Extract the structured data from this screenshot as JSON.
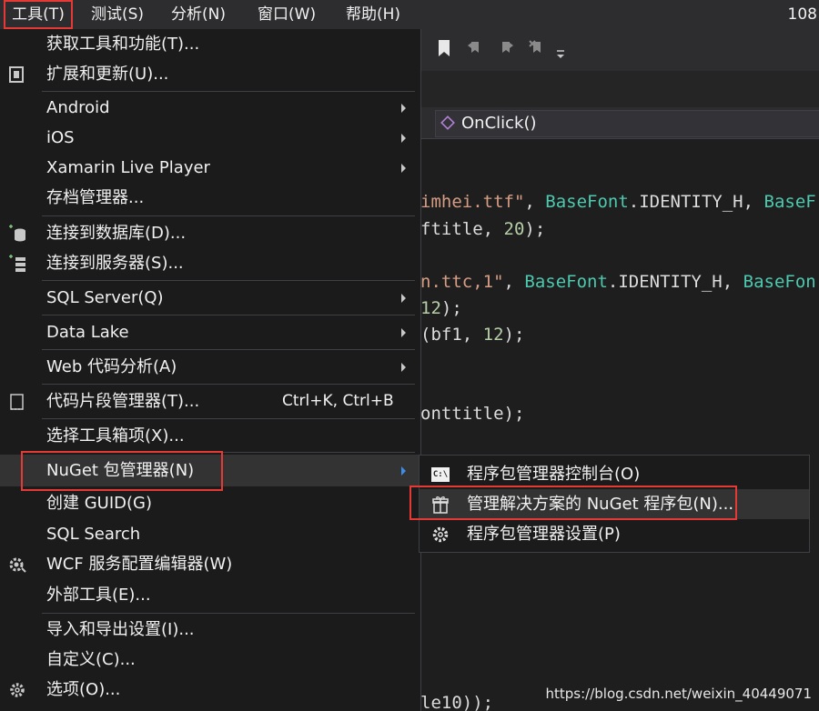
{
  "menubar": {
    "items": [
      "工具(T)",
      "测试(S)",
      "分析(N)",
      "窗口(W)",
      "帮助(H)"
    ],
    "right_text": "108"
  },
  "nav": {
    "method": "OnClick()"
  },
  "code_lines": [
    {
      "parts": [
        [
          "str",
          "imhei.ttf\""
        ],
        [
          "pln",
          ", "
        ],
        [
          "typ",
          "BaseFont"
        ],
        [
          "pln",
          ".IDENTITY_H, "
        ],
        [
          "typ",
          "BaseF"
        ]
      ]
    },
    {
      "parts": [
        [
          "pln",
          "ftitle, "
        ],
        [
          "num",
          "20"
        ],
        [
          "pln",
          ");"
        ]
      ]
    },
    {
      "parts": [
        [
          "str",
          "n.ttc,1\""
        ],
        [
          "pln",
          ", "
        ],
        [
          "typ",
          "BaseFont"
        ],
        [
          "pln",
          ".IDENTITY_H, "
        ],
        [
          "typ",
          "BaseFon"
        ]
      ]
    },
    {
      "parts": [
        [
          "num",
          "12"
        ],
        [
          "pln",
          ");"
        ]
      ]
    },
    {
      "parts": [
        [
          "pln",
          "(bf1, "
        ],
        [
          "num",
          "12"
        ],
        [
          "pln",
          ");"
        ]
      ]
    },
    {
      "parts": [
        [
          "pln",
          "onttitle);"
        ]
      ]
    },
    {
      "parts": [
        [
          "pln",
          "le10));"
        ]
      ]
    }
  ],
  "menu": {
    "items": [
      {
        "label": "获取工具和功能(T)...",
        "icon": "",
        "submenu": false
      },
      {
        "label": "扩展和更新(U)...",
        "icon": "extensions-icon",
        "submenu": false
      },
      {
        "label": "Android",
        "icon": "",
        "submenu": true
      },
      {
        "label": "iOS",
        "icon": "",
        "submenu": true
      },
      {
        "label": "Xamarin Live Player",
        "icon": "",
        "submenu": true
      },
      {
        "label": "存档管理器...",
        "icon": "",
        "submenu": false
      },
      {
        "label": "连接到数据库(D)...",
        "icon": "database-connect-icon",
        "submenu": false
      },
      {
        "label": "连接到服务器(S)...",
        "icon": "server-connect-icon",
        "submenu": false
      },
      {
        "label": "SQL Server(Q)",
        "icon": "",
        "submenu": true
      },
      {
        "label": "Data Lake",
        "icon": "",
        "submenu": true
      },
      {
        "label": "Web 代码分析(A)",
        "icon": "",
        "submenu": true
      },
      {
        "label": "代码片段管理器(T)...",
        "icon": "snippet-icon",
        "submenu": false,
        "shortcut": "Ctrl+K, Ctrl+B"
      },
      {
        "label": "选择工具箱项(X)...",
        "icon": "",
        "submenu": false
      },
      {
        "label": "NuGet 包管理器(N)",
        "icon": "",
        "submenu": true
      },
      {
        "label": "创建 GUID(G)",
        "icon": "",
        "submenu": false
      },
      {
        "label": "SQL Search",
        "icon": "",
        "submenu": false
      },
      {
        "label": "WCF 服务配置编辑器(W)",
        "icon": "wcf-gear-icon",
        "submenu": false
      },
      {
        "label": "外部工具(E)...",
        "icon": "",
        "submenu": false
      },
      {
        "label": "导入和导出设置(I)...",
        "icon": "",
        "submenu": false
      },
      {
        "label": "自定义(C)...",
        "icon": "",
        "submenu": false
      },
      {
        "label": "选项(O)...",
        "icon": "gear-icon",
        "submenu": false
      }
    ]
  },
  "submenu": {
    "items": [
      {
        "label": "程序包管理器控制台(O)",
        "icon": "console-icon",
        "icon_text": "C:\\"
      },
      {
        "label": "管理解决方案的 NuGet 程序包(N)...",
        "icon": "package-icon"
      },
      {
        "label": "程序包管理器设置(P)",
        "icon": "gear-icon"
      }
    ]
  },
  "watermark": "https://blog.csdn.net/weixin_40449071",
  "colors": {
    "highlight_box": "#e53935",
    "menu_bg": "#1b1b1c",
    "selected_bg": "#333334"
  }
}
